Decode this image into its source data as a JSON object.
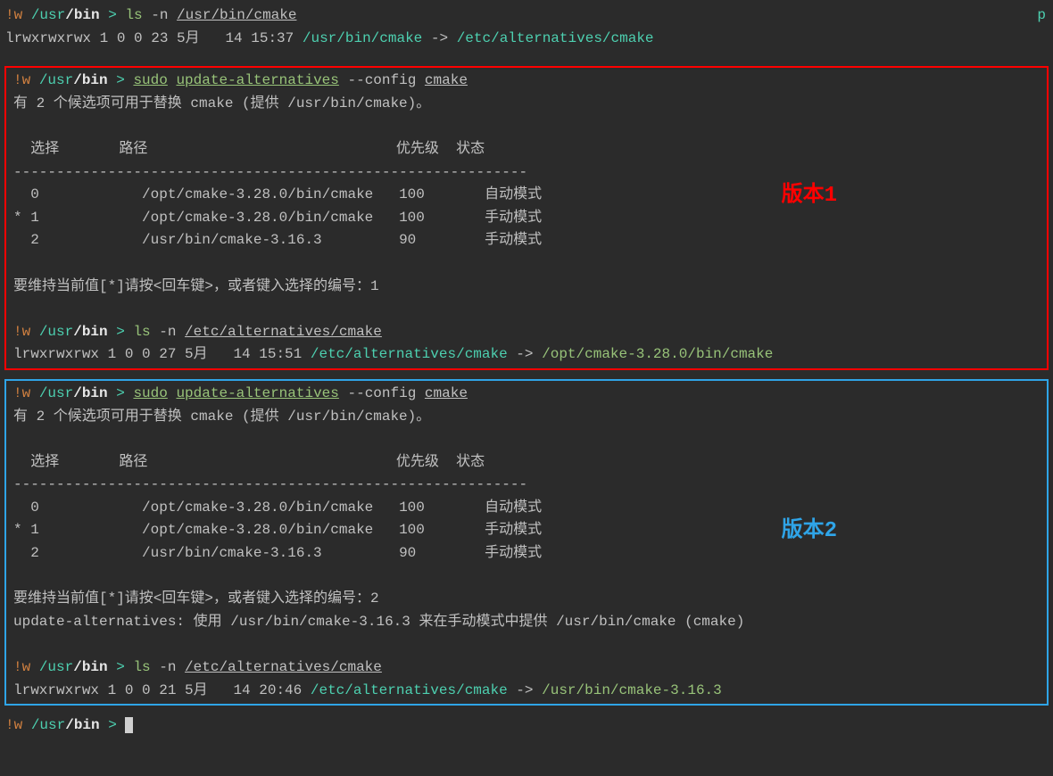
{
  "top_p": "p",
  "top": {
    "prompt_w": "!w ",
    "path_usr": "/usr",
    "path_bin": "/bin",
    "prompt_arrow": " > ",
    "cmd_ls": "ls",
    "cmd_flags": " -n ",
    "cmd_path": "/usr/bin/cmake",
    "out_perms": "lrwxrwxrwx 1 0 0 23 5月   14 15:37 ",
    "out_link1": "/usr/bin/cmake",
    "out_arrow": " -> ",
    "out_link2": "/etc/alternatives/cmake"
  },
  "box1": {
    "annotation": "版本1",
    "prompt1": {
      "w": "!w ",
      "usr": "/usr",
      "bin": "/bin",
      "arr": " > ",
      "sudo": "sudo",
      "sp": " ",
      "ua": "update-alternatives",
      "flags": " --config ",
      "cm": "cmake"
    },
    "msg1": "有 2 个候选项可用于替换 cmake (提供 /usr/bin/cmake)。",
    "header": "  选择       路径                             优先级  状态",
    "divider": "------------------------------------------------------------",
    "row0": "  0            /opt/cmake-3.28.0/bin/cmake   100       自动模式",
    "row1": "* 1            /opt/cmake-3.28.0/bin/cmake   100       手动模式",
    "row2": "  2            /usr/bin/cmake-3.16.3         90        手动模式",
    "ask": "要维持当前值[*]请按<回车键>，或者键入选择的编号：1",
    "prompt2": {
      "w": "!w ",
      "usr": "/usr",
      "bin": "/bin",
      "arr": " > ",
      "ls": "ls",
      "flags": " -n ",
      "path": "/etc/alternatives/cmake"
    },
    "out": {
      "perms": "lrwxrwxrwx 1 0 0 27 5月   14 15:51 ",
      "link1": "/etc/alternatives/cmake",
      "arrow": " -> ",
      "link2": "/opt/cmake-3.28.0/bin/cmake"
    }
  },
  "box2": {
    "annotation": "版本2",
    "prompt1": {
      "w": "!w ",
      "usr": "/usr",
      "bin": "/bin",
      "arr": " > ",
      "sudo": "sudo",
      "sp": " ",
      "ua": "update-alternatives",
      "flags": " --config ",
      "cm": "cmake"
    },
    "msg1": "有 2 个候选项可用于替换 cmake (提供 /usr/bin/cmake)。",
    "header": "  选择       路径                             优先级  状态",
    "divider": "------------------------------------------------------------",
    "row0": "  0            /opt/cmake-3.28.0/bin/cmake   100       自动模式",
    "row1": "* 1            /opt/cmake-3.28.0/bin/cmake   100       手动模式",
    "row2": "  2            /usr/bin/cmake-3.16.3         90        手动模式",
    "ask": "要维持当前值[*]请按<回车键>，或者键入选择的编号：2",
    "result": "update-alternatives: 使用 /usr/bin/cmake-3.16.3 来在手动模式中提供 /usr/bin/cmake (cmake)",
    "prompt2": {
      "w": "!w ",
      "usr": "/usr",
      "bin": "/bin",
      "arr": " > ",
      "ls": "ls",
      "flags": " -n ",
      "path": "/etc/alternatives/cmake"
    },
    "out": {
      "perms": "lrwxrwxrwx 1 0 0 21 5月   14 20:46 ",
      "link1": "/etc/alternatives/cmake",
      "arrow": " -> ",
      "link2": "/usr/bin/cmake-3.16.3"
    }
  },
  "final": {
    "w": "!w ",
    "usr": "/usr",
    "bin": "/bin",
    "arr": " > "
  }
}
